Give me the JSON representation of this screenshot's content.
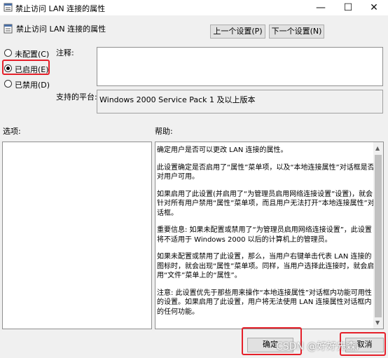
{
  "window": {
    "title": "禁止访问 LAN 连接的属性",
    "minimize_glyph": "—",
    "maximize_glyph": "☐",
    "close_glyph": "✕"
  },
  "header": {
    "policy_name": "禁止访问 LAN 连接的属性",
    "prev_button": "上一个设置(P)",
    "next_button": "下一个设置(N)"
  },
  "state": {
    "options": [
      "未配置(C)",
      "已启用(E)",
      "已禁用(D)"
    ],
    "selected": "已启用(E)"
  },
  "comment": {
    "label": "注释:",
    "value": ""
  },
  "platform": {
    "label": "支持的平台:",
    "value": "Windows 2000 Service Pack 1 及以上版本"
  },
  "options_label": "选项:",
  "help": {
    "label": "帮助:",
    "paragraphs": [
      "确定用户是否可以更改 LAN 连接的属性。",
      "此设置确定是否启用了“属性”菜单项，以及“本地连接属性”对话框是否对用户可用。",
      "如果启用了此设置(并启用了“为管理员启用网络连接设置”设置)，就会针对所有用户禁用“属性”菜单项，而且用户无法打开“本地连接属性”对话框。",
      "重要信息: 如果未配置或禁用了“为管理员启用网络连接设置”，此设置将不适用于 Windows 2000 以后的计算机上的管理员。",
      "如果未配置或禁用了此设置，那么，当用户右键单击代表 LAN 连接的图标时，就会出现“属性”菜单项。同样，当用户选择此连接时，就会启用“文件”菜单上的“属性”。",
      "注意: 此设置优先于那些用来操作“本地连接属性”对话框内功能可用性的设置。如果启用了此设置，用户将无法使用 LAN 连接属性对话框内的任何功能。"
    ]
  },
  "footer": {
    "ok_button": "确定",
    "cancel_button": "取消"
  },
  "watermark": "CSDN @好好先森i",
  "colors": {
    "highlight": "#e5202a"
  }
}
